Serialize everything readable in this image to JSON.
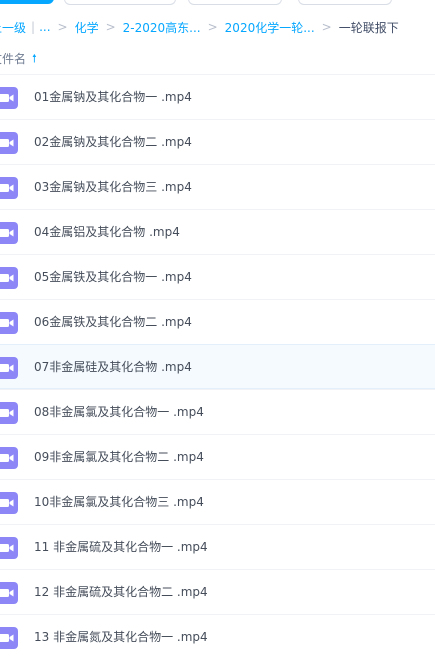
{
  "breadcrumb": {
    "back": "上一级",
    "ellipsis": "...",
    "items": [
      "化学",
      "2-2020高东...",
      "2020化学一轮..."
    ],
    "current": "一轮联报下",
    "separator": ">"
  },
  "list_header": {
    "column": "文件名",
    "sort_icon": "arrow-up-icon"
  },
  "colors": {
    "accent": "#06a7ff",
    "video_icon": "#8c86f7"
  },
  "files": [
    {
      "name": "01金属钠及其化合物一 .mp4",
      "icon": "video-file-icon"
    },
    {
      "name": "02金属钠及其化合物二 .mp4",
      "icon": "video-file-icon"
    },
    {
      "name": "03金属钠及其化合物三 .mp4",
      "icon": "video-file-icon"
    },
    {
      "name": "04金属铝及其化合物 .mp4",
      "icon": "video-file-icon"
    },
    {
      "name": "05金属铁及其化合物一 .mp4",
      "icon": "video-file-icon"
    },
    {
      "name": "06金属铁及其化合物二 .mp4",
      "icon": "video-file-icon"
    },
    {
      "name": "07非金属硅及其化合物 .mp4",
      "icon": "video-file-icon",
      "hovered": true
    },
    {
      "name": "08非金属氯及其化合物一 .mp4",
      "icon": "video-file-icon"
    },
    {
      "name": "09非金属氯及其化合物二 .mp4",
      "icon": "video-file-icon"
    },
    {
      "name": "10非金属氯及其化合物三 .mp4",
      "icon": "video-file-icon"
    },
    {
      "name": "11 非金属硫及其化合物一 .mp4",
      "icon": "video-file-icon"
    },
    {
      "name": "12 非金属硫及其化合物二 .mp4",
      "icon": "video-file-icon"
    },
    {
      "name": "13 非金属氮及其化合物一 .mp4",
      "icon": "video-file-icon"
    }
  ]
}
